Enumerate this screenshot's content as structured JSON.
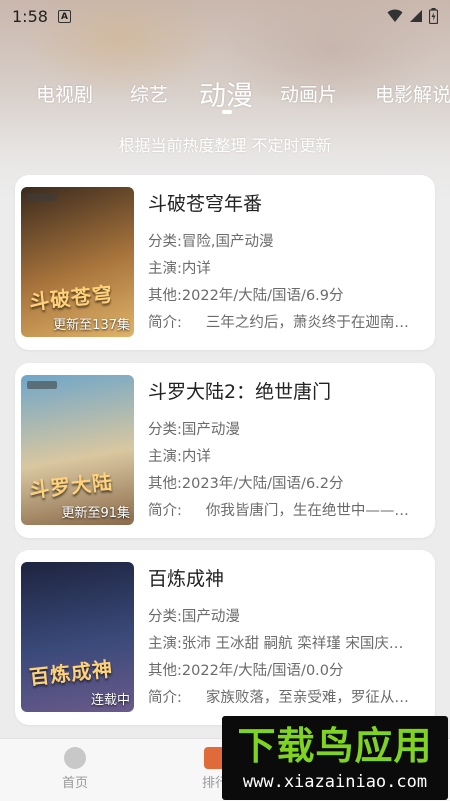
{
  "status_bar": {
    "time": "1:58",
    "notification_letter": "A"
  },
  "tabs": [
    {
      "label": "电视剧",
      "active": false
    },
    {
      "label": "综艺",
      "active": false
    },
    {
      "label": "动漫",
      "active": true
    },
    {
      "label": "动画片",
      "active": false
    },
    {
      "label": "电影解说",
      "active": false
    }
  ],
  "subtitle": "根据当前热度整理 不定时更新",
  "field_labels": {
    "category": "分类:",
    "cast": "主演:",
    "other": "其他:",
    "intro": "简介:"
  },
  "items": [
    {
      "title": "斗破苍穹年番",
      "category": "冒险,国产动漫",
      "cast": "内详",
      "other": "2022年/大陆/国语/6.9分",
      "intro": "三年之约后，萧炎终于在迦南…",
      "badge": "更新至137集",
      "poster_art": "斗破苍穹",
      "poster_colors": [
        "#3a2a1e",
        "#a8743c",
        "#e0b46a"
      ]
    },
    {
      "title": "斗罗大陆2：绝世唐门",
      "category": "国产动漫",
      "cast": "内详",
      "other": "2023年/大陆/国语/6.2分",
      "intro": "你我皆唐门，生在绝世中——…",
      "badge": "更新至91集",
      "poster_art": "斗罗大陆",
      "poster_colors": [
        "#6fa6c9",
        "#d9c7a0",
        "#8a6a4a"
      ]
    },
    {
      "title": "百炼成神",
      "category": "国产动漫",
      "cast": "张沛 王冰甜 嗣航 栾祥瑾 宋国庆…",
      "other": "2022年/大陆/国语/0.0分",
      "intro": "家族败落，至亲受难，罗征从…",
      "badge": "连载中",
      "poster_art": "百炼成神",
      "poster_colors": [
        "#1e2440",
        "#3a4a7a",
        "#6a5a8a"
      ]
    }
  ],
  "bottom_nav": [
    {
      "label": "首页",
      "icon": "home-icon"
    },
    {
      "label": "排行",
      "icon": "ranking-icon"
    }
  ],
  "watermark": {
    "title": "下载鸟应用",
    "url": "www.xiazainiao.com"
  },
  "colors": {
    "tab_text": "#ffffff",
    "card_bg": "#ffffff",
    "watermark_green": "#7fd321"
  }
}
